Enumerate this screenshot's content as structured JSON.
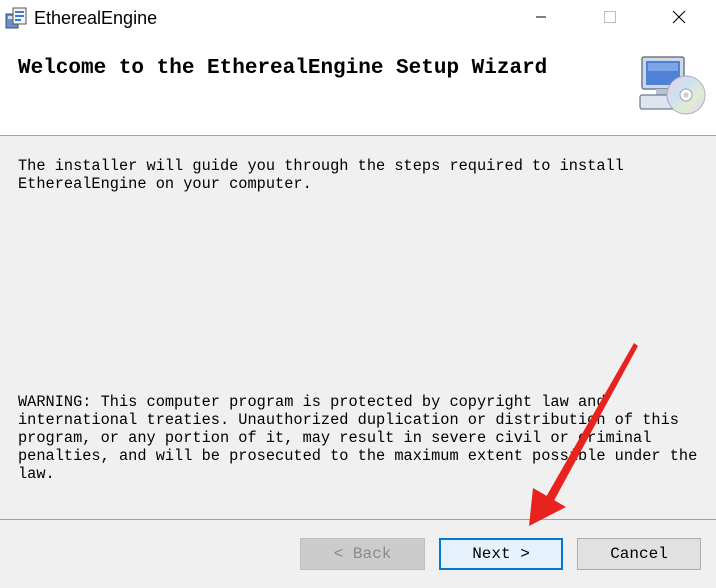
{
  "window": {
    "title": "EtherealEngine",
    "icon": "installer-package-icon",
    "controls": {
      "minimize": "minimize-icon",
      "maximize": "maximize-icon",
      "close": "close-icon"
    }
  },
  "header": {
    "title": "Welcome to the EtherealEngine Setup Wizard",
    "icon": "computer-disc-icon"
  },
  "body": {
    "intro": "The installer will guide you through the steps required to install\nEtherealEngine on your computer.",
    "warning": "WARNING: This computer program is protected by copyright law and\ninternational treaties. Unauthorized duplication or distribution of this\nprogram, or any portion of it, may result in severe civil or criminal\npenalties, and will be prosecuted to the maximum extent possible under the\nlaw."
  },
  "buttons": {
    "back": "< Back",
    "next": "Next >",
    "cancel": "Cancel"
  },
  "colors": {
    "accent": "#0078d7",
    "annotation_arrow": "#e8231f"
  }
}
